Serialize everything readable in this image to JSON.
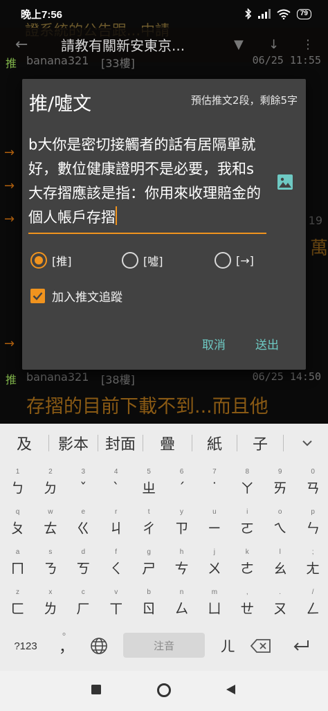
{
  "status_bar": {
    "time": "晚上7:56",
    "battery": "79",
    "icons": [
      "bluetooth-icon",
      "signal-icon",
      "wifi-icon",
      "battery-icon"
    ]
  },
  "background": {
    "ghost_title": "證系統的公告跟...中請",
    "appbar_title": "請教有關新安東京...",
    "push_top": {
      "tag": "推",
      "user": "banana321",
      "floor": "[33樓]",
      "date": "06/25 11:55"
    },
    "push_bottom": {
      "tag": "推",
      "user": "banana321",
      "floor": "[38樓]",
      "date": "06/25 14:50"
    },
    "arrows": [
      "→",
      "→",
      "→",
      "→"
    ],
    "side_number": "19",
    "side_glyph": "萬",
    "body_text": "存摺的目前下載不到...而且他"
  },
  "dialog": {
    "title": "推/噓文",
    "hint": "預估推文2段，剩餘5字",
    "text": "b大你是密切接觸者的話有居隔單就好，數位健康證明不是必要，我和s大存摺應該是指：你用來收理賠金的個人帳戶存摺",
    "radios": [
      {
        "label": "[推]",
        "selected": true
      },
      {
        "label": "[噓]",
        "selected": false
      },
      {
        "label": "[→]",
        "selected": false
      }
    ],
    "checkbox_label": "加入推文追蹤",
    "checkbox_checked": true,
    "cancel_label": "取消",
    "send_label": "送出",
    "accent": "#f0931e",
    "button_color": "#6ec9c3"
  },
  "keyboard": {
    "suggestions": [
      "及",
      "影本",
      "封面",
      "疊",
      "紙",
      "子"
    ],
    "rows": [
      {
        "hints": [
          "1",
          "2",
          "3",
          "4",
          "5",
          "6",
          "7",
          "8",
          "9",
          "0"
        ],
        "keys": [
          "ㄅ",
          "ㄉ",
          "ˇ",
          "ˋ",
          "ㄓ",
          "ˊ",
          "˙",
          "ㄚ",
          "ㄞ",
          "ㄢ"
        ]
      },
      {
        "hints": [
          "q",
          "w",
          "e",
          "r",
          "t",
          "y",
          "u",
          "i",
          "o",
          "p"
        ],
        "keys": [
          "ㄆ",
          "ㄊ",
          "ㄍ",
          "ㄐ",
          "ㄔ",
          "ㄗ",
          "ㄧ",
          "ㄛ",
          "ㄟ",
          "ㄣ"
        ]
      },
      {
        "hints": [
          "a",
          "s",
          "d",
          "f",
          "g",
          "h",
          "j",
          "k",
          "l",
          ";"
        ],
        "keys": [
          "ㄇ",
          "ㄋ",
          "ㄎ",
          "ㄑ",
          "ㄕ",
          "ㄘ",
          "ㄨ",
          "ㄜ",
          "ㄠ",
          "ㄤ"
        ]
      },
      {
        "hints": [
          "z",
          "x",
          "c",
          "v",
          "b",
          "n",
          "m",
          ",",
          ".",
          "/"
        ],
        "keys": [
          "ㄈ",
          "ㄌ",
          "ㄏ",
          "ㄒ",
          "ㄖ",
          "ㄙ",
          "ㄩ",
          "ㄝ",
          "ㄡ",
          "ㄥ"
        ]
      }
    ],
    "symbols_key": "?123",
    "punct_key": "，",
    "punct_hint": "。",
    "space_label": "注音",
    "er_key": "ㄦ"
  }
}
